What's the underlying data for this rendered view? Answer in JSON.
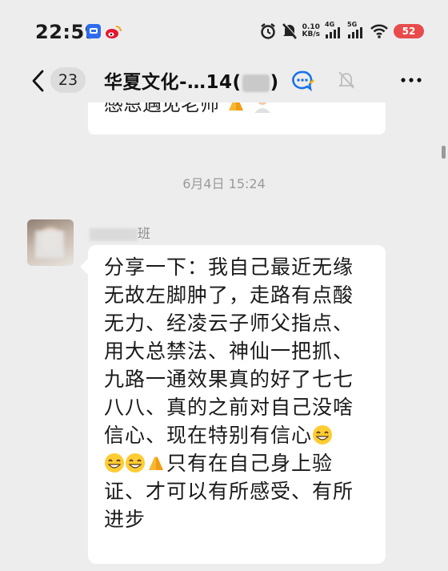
{
  "status_bar": {
    "time": "22:59",
    "net_speed_value": "0.10",
    "net_speed_unit": "KB/s",
    "signal1_label": "4G",
    "signal2_label": "5G",
    "battery_level": "52",
    "icons": [
      "alarm-icon",
      "mute-icon",
      "signal-icon",
      "wifi-icon",
      "battery-icon"
    ]
  },
  "header": {
    "unread_count": "23",
    "title_prefix": "华夏文化-…14(",
    "title_suffix": ")",
    "icons": [
      "back-chevron-icon",
      "group-chat-icon",
      "mute-bell-icon",
      "more-icon"
    ]
  },
  "chat": {
    "previous_message_text": "感恩遇见老师",
    "timestamp": "6月4日 15:24",
    "sender_name_suffix": "班",
    "message_lines": [
      "分享一下：我自己最近无缘",
      "无故左脚肿了，走路有点酸",
      "无力、经凌云子师父指点、",
      "用大总禁法、神仙一把抓、",
      "九路一通效果真的好了七七",
      "八八、真的之前对自己没啥",
      "信心、现在特别有信心",
      "只有在自己身上验",
      "证、才可以有所感受、有所",
      "进步"
    ]
  },
  "colors": {
    "background": "#ededed",
    "bubble": "#ffffff",
    "timestamp": "#9a9a9a",
    "battery": "#e84b4b",
    "accent_blue": "#1a73e8"
  }
}
